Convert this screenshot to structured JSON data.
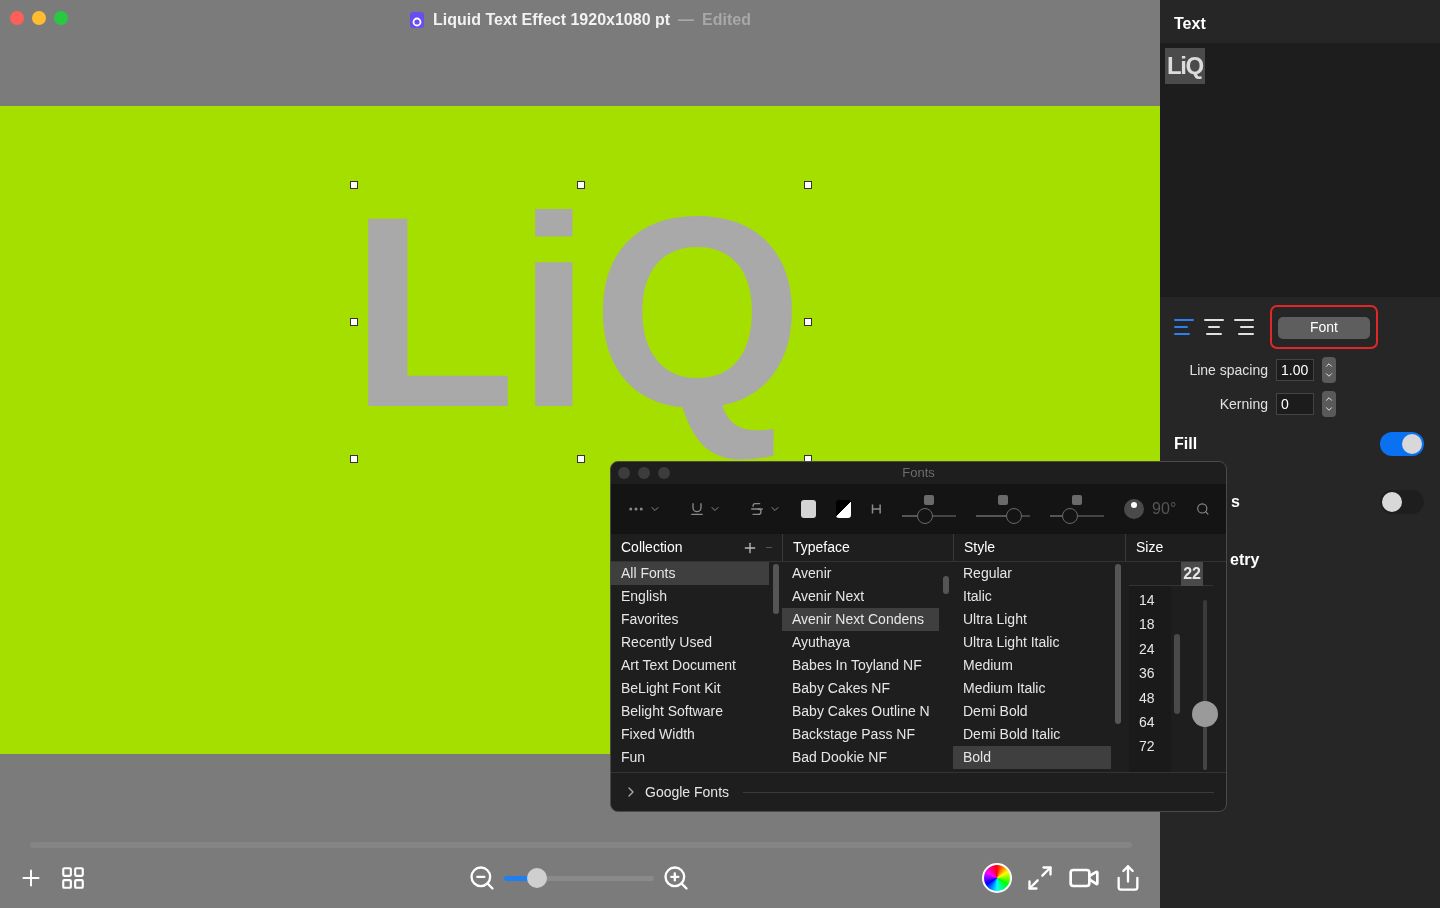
{
  "window": {
    "title": "Liquid Text Effect 1920x1080 pt",
    "separator": "—",
    "status": "Edited"
  },
  "canvas": {
    "artwork_text": "LiQ",
    "zoom": {
      "level": 0.22
    }
  },
  "inspector": {
    "title": "Text",
    "preview": "LiQ",
    "alignments": [
      {
        "kind": "left",
        "selected": true
      },
      {
        "kind": "center",
        "selected": false
      },
      {
        "kind": "right",
        "selected": false
      }
    ],
    "font_button": "Font",
    "line_spacing": {
      "label": "Line spacing",
      "value": "1.00"
    },
    "kerning": {
      "label": "Kerning",
      "value": "0"
    },
    "sections": [
      {
        "label": "Fill",
        "on": true
      },
      {
        "label": "s",
        "on": false
      },
      {
        "label": "etry"
      }
    ]
  },
  "fonts_panel": {
    "title": "Fonts",
    "angle": "90°",
    "shadow_sliders": [
      {
        "level": 0.4
      },
      {
        "level": 0.8
      },
      {
        "level": 0.32
      }
    ],
    "columns": [
      "Collection",
      "Typeface",
      "Style",
      "Size"
    ],
    "collections": [
      {
        "label": "All Fonts",
        "selected": true
      },
      {
        "label": "English",
        "selected": false
      },
      {
        "label": "Favorites",
        "selected": false
      },
      {
        "label": "Recently Used",
        "selected": false
      },
      {
        "label": "Art Text Document",
        "selected": false
      },
      {
        "label": "BeLight Font Kit",
        "selected": false
      },
      {
        "label": "Belight Software",
        "selected": false
      },
      {
        "label": "Fixed Width",
        "selected": false
      },
      {
        "label": "Fun",
        "selected": false
      }
    ],
    "typefaces": [
      {
        "label": "Avenir",
        "selected": false
      },
      {
        "label": "Avenir Next",
        "selected": false
      },
      {
        "label": "Avenir Next Condens",
        "selected": true
      },
      {
        "label": "Ayuthaya",
        "selected": false
      },
      {
        "label": "Babes In Toyland NF",
        "selected": false
      },
      {
        "label": "Baby Cakes NF",
        "selected": false
      },
      {
        "label": "Baby Cakes Outline N",
        "selected": false
      },
      {
        "label": "Backstage Pass NF",
        "selected": false
      },
      {
        "label": "Bad Dookie NF",
        "selected": false
      }
    ],
    "styles": [
      {
        "label": "Regular",
        "selected": false
      },
      {
        "label": "Italic",
        "selected": false
      },
      {
        "label": "Ultra Light",
        "selected": false
      },
      {
        "label": "Ultra Light Italic",
        "selected": false
      },
      {
        "label": "Medium",
        "selected": false
      },
      {
        "label": "Medium Italic",
        "selected": false
      },
      {
        "label": "Demi Bold",
        "selected": false
      },
      {
        "label": "Demi Bold Italic",
        "selected": false
      },
      {
        "label": "Bold",
        "selected": true
      }
    ],
    "size_value": "22",
    "sizes": [
      "14",
      "18",
      "24",
      "36",
      "48",
      "64",
      "72"
    ],
    "size_slider": {
      "level": 0.3
    },
    "footer": "Google Fonts"
  }
}
